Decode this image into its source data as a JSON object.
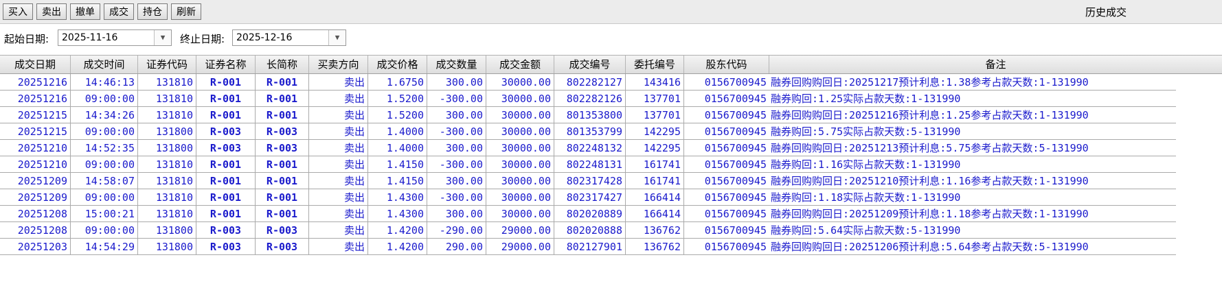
{
  "toolbar": {
    "buttons": [
      "买入",
      "卖出",
      "撤单",
      "成交",
      "持仓",
      "刷新"
    ],
    "title": "历史成交"
  },
  "filter": {
    "start_label": "起始日期:",
    "start_value": "2025-11-16",
    "end_label": "终止日期:",
    "end_value": "2025-12-16",
    "dropdown_glyph": "▼"
  },
  "table": {
    "columns": [
      "成交日期",
      "成交时间",
      "证券代码",
      "证券名称",
      "长简称",
      "买卖方向",
      "成交价格",
      "成交数量",
      "成交金额",
      "成交编号",
      "委托编号",
      "股东代码",
      "备注"
    ],
    "rows": [
      [
        "20251216",
        "14:46:13",
        "131810",
        "R-001",
        "R-001",
        "卖出",
        "1.6750",
        "300.00",
        "30000.00",
        "802282127",
        "143416",
        "0156700945",
        "融券回购购回日:20251217预计利息:1.38参考占款天数:1-131990"
      ],
      [
        "20251216",
        "09:00:00",
        "131810",
        "R-001",
        "R-001",
        "卖出",
        "1.5200",
        "-300.00",
        "30000.00",
        "802282126",
        "137701",
        "0156700945",
        "融券购回:1.25实际占款天数:1-131990"
      ],
      [
        "20251215",
        "14:34:26",
        "131810",
        "R-001",
        "R-001",
        "卖出",
        "1.5200",
        "300.00",
        "30000.00",
        "801353800",
        "137701",
        "0156700945",
        "融券回购购回日:20251216预计利息:1.25参考占款天数:1-131990"
      ],
      [
        "20251215",
        "09:00:00",
        "131800",
        "R-003",
        "R-003",
        "卖出",
        "1.4000",
        "-300.00",
        "30000.00",
        "801353799",
        "142295",
        "0156700945",
        "融券购回:5.75实际占款天数:5-131990"
      ],
      [
        "20251210",
        "14:52:35",
        "131800",
        "R-003",
        "R-003",
        "卖出",
        "1.4000",
        "300.00",
        "30000.00",
        "802248132",
        "142295",
        "0156700945",
        "融券回购购回日:20251213预计利息:5.75参考占款天数:5-131990"
      ],
      [
        "20251210",
        "09:00:00",
        "131810",
        "R-001",
        "R-001",
        "卖出",
        "1.4150",
        "-300.00",
        "30000.00",
        "802248131",
        "161741",
        "0156700945",
        "融券购回:1.16实际占款天数:1-131990"
      ],
      [
        "20251209",
        "14:58:07",
        "131810",
        "R-001",
        "R-001",
        "卖出",
        "1.4150",
        "300.00",
        "30000.00",
        "802317428",
        "161741",
        "0156700945",
        "融券回购购回日:20251210预计利息:1.16参考占款天数:1-131990"
      ],
      [
        "20251209",
        "09:00:00",
        "131810",
        "R-001",
        "R-001",
        "卖出",
        "1.4300",
        "-300.00",
        "30000.00",
        "802317427",
        "166414",
        "0156700945",
        "融券购回:1.18实际占款天数:1-131990"
      ],
      [
        "20251208",
        "15:00:21",
        "131810",
        "R-001",
        "R-001",
        "卖出",
        "1.4300",
        "300.00",
        "30000.00",
        "802020889",
        "166414",
        "0156700945",
        "融券回购购回日:20251209预计利息:1.18参考占款天数:1-131990"
      ],
      [
        "20251208",
        "09:00:00",
        "131800",
        "R-003",
        "R-003",
        "卖出",
        "1.4200",
        "-290.00",
        "29000.00",
        "802020888",
        "136762",
        "0156700945",
        "融券购回:5.64实际占款天数:5-131990"
      ],
      [
        "20251203",
        "14:54:29",
        "131800",
        "R-003",
        "R-003",
        "卖出",
        "1.4200",
        "290.00",
        "29000.00",
        "802127901",
        "136762",
        "0156700945",
        "融券回购购回日:20251206预计利息:5.64参考占款天数:5-131990"
      ]
    ]
  },
  "colors": {
    "row_text": "#1a1acc"
  }
}
